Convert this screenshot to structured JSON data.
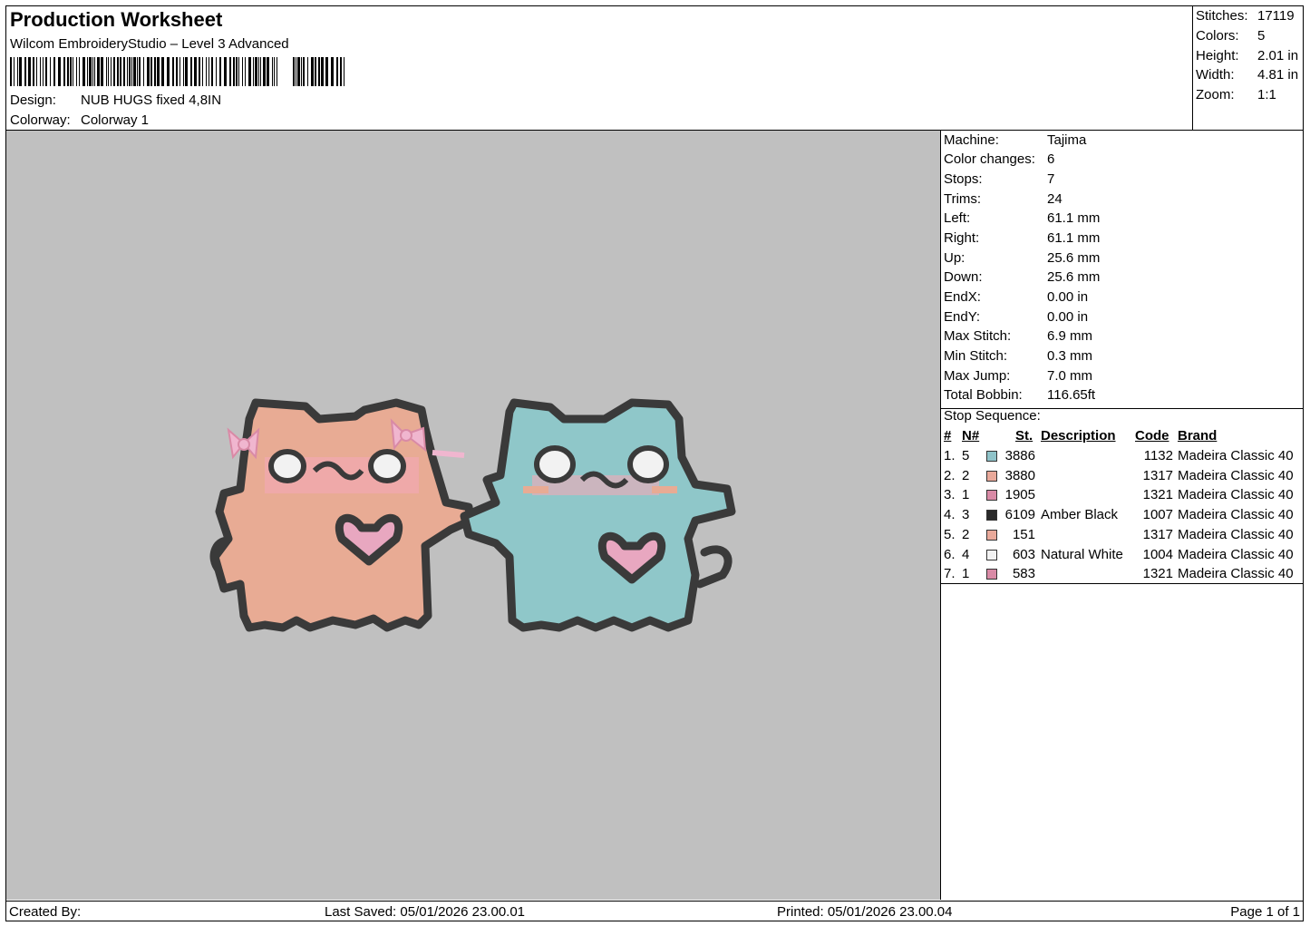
{
  "header": {
    "title": "Production Worksheet",
    "software": "Wilcom EmbroideryStudio – Level 3 Advanced",
    "design_label": "Design:",
    "design_value": "NUB HUGS fixed 4,8IN",
    "colorway_label": "Colorway:",
    "colorway_value": "Colorway 1"
  },
  "summary": [
    {
      "label": "Stitches:",
      "value": "17119"
    },
    {
      "label": "Colors:",
      "value": "5"
    },
    {
      "label": "Height:",
      "value": "2.01 in"
    },
    {
      "label": "Width:",
      "value": "4.81 in"
    },
    {
      "label": "Zoom:",
      "value": "1:1"
    }
  ],
  "machine_info": [
    {
      "label": "Machine:",
      "value": "Tajima"
    },
    {
      "label": "Color changes:",
      "value": "6"
    },
    {
      "label": "Stops:",
      "value": "7"
    },
    {
      "label": "Trims:",
      "value": "24"
    },
    {
      "label": "Left:",
      "value": "61.1 mm"
    },
    {
      "label": "Right:",
      "value": "61.1 mm"
    },
    {
      "label": "Up:",
      "value": "25.6 mm"
    },
    {
      "label": "Down:",
      "value": "25.6 mm"
    },
    {
      "label": "EndX:",
      "value": "0.00 in"
    },
    {
      "label": "EndY:",
      "value": "0.00 in"
    },
    {
      "label": "Max Stitch:",
      "value": "6.9 mm"
    },
    {
      "label": "Min Stitch:",
      "value": "0.3 mm"
    },
    {
      "label": "Max Jump:",
      "value": "7.0 mm"
    },
    {
      "label": "Total Bobbin:",
      "value": "116.65ft"
    }
  ],
  "stop_sequence": {
    "title": "Stop Sequence:",
    "columns": {
      "num": "#",
      "n": "N#",
      "st": "St.",
      "description": "Description",
      "code": "Code",
      "brand": "Brand"
    },
    "rows": [
      {
        "num": "1.",
        "n": "5",
        "st": "3886",
        "description": "",
        "code": "1132",
        "brand": "Madeira Classic 40",
        "color": "#8fc3c9"
      },
      {
        "num": "2.",
        "n": "2",
        "st": "3880",
        "description": "",
        "code": "1317",
        "brand": "Madeira Classic 40",
        "color": "#e9a99a"
      },
      {
        "num": "3.",
        "n": "1",
        "st": "1905",
        "description": "",
        "code": "1321",
        "brand": "Madeira Classic 40",
        "color": "#d98aa6"
      },
      {
        "num": "4.",
        "n": "3",
        "st": "6109",
        "description": "Amber Black",
        "code": "1007",
        "brand": "Madeira Classic 40",
        "color": "#2a2a2a"
      },
      {
        "num": "5.",
        "n": "2",
        "st": "151",
        "description": "",
        "code": "1317",
        "brand": "Madeira Classic 40",
        "color": "#e9a99a"
      },
      {
        "num": "6.",
        "n": "4",
        "st": "603",
        "description": "Natural White",
        "code": "1004",
        "brand": "Madeira Classic 40",
        "color": "#f2f2f2"
      },
      {
        "num": "7.",
        "n": "1",
        "st": "583",
        "description": "",
        "code": "1321",
        "brand": "Madeira Classic 40",
        "color": "#d98aa6"
      }
    ]
  },
  "footer": {
    "created_by": "Created By:",
    "last_saved": "Last Saved: 05/01/2026 23.00.01",
    "printed": "Printed: 05/01/2026 23.00.04",
    "page": "Page 1 of 1"
  },
  "design_colors": {
    "peach": "#e8ab94",
    "teal": "#8fc7c9",
    "outline": "#3a3a3a",
    "pink": "#e8a7c0",
    "white": "#f2f2f2",
    "canvas_bg": "#c0c0c0"
  }
}
